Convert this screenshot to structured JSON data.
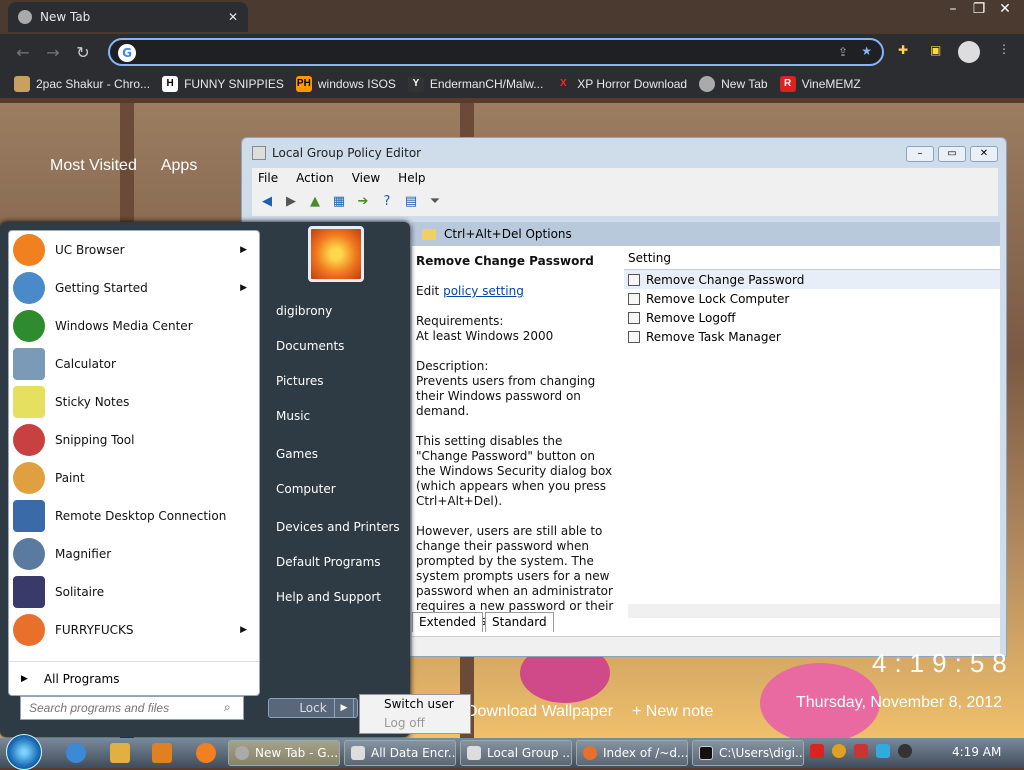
{
  "chrome": {
    "tab_title": "New Tab",
    "omnibox_value": "",
    "bookmarks": [
      {
        "label": "2pac Shakur - Chro...",
        "icon": "house-icon"
      },
      {
        "label": "FUNNY SNIPPIES",
        "icon": "h-letter-icon"
      },
      {
        "label": "windows ISOS",
        "icon": "ph-icon"
      },
      {
        "label": "EndermanCH/Malw...",
        "icon": "yp-icon"
      },
      {
        "label": "XP Horror Download",
        "icon": "x-icon"
      },
      {
        "label": "New Tab",
        "icon": "chrome-icon"
      },
      {
        "label": "VineMEMZ",
        "icon": "r-icon"
      }
    ],
    "ntp_most_visited": "Most Visited",
    "ntp_apps": "Apps"
  },
  "gpedit": {
    "title": "Local Group Policy Editor",
    "menu": [
      "File",
      "Action",
      "View",
      "Help"
    ],
    "header": "Ctrl+Alt+Del Options",
    "column_setting": "Setting",
    "desc_title": "Remove Change Password",
    "edit_prefix": "Edit",
    "edit_link": "policy setting",
    "requirements_label": "Requirements:",
    "requirements_value": "At least Windows 2000",
    "description_label": "Description:",
    "description_1": "Prevents users from changing their Windows password on demand.",
    "description_2": "This setting disables the \"Change Password\" button on the Windows Security dialog box (which appears when you press Ctrl+Alt+Del).",
    "description_3": "However, users are still able to change their password when prompted by the system. The system prompts users for a new password when an administrator requires a new password or their password is expiring.",
    "settings": [
      "Remove Change Password",
      "Remove Lock Computer",
      "Remove Logoff",
      "Remove Task Manager"
    ],
    "tabs": [
      "Extended",
      "Standard"
    ]
  },
  "startmenu": {
    "programs": [
      {
        "label": "UC Browser",
        "icon": "uc-browser-icon",
        "color": "#f08020",
        "submenu": true
      },
      {
        "label": "Getting Started",
        "icon": "getting-started-icon",
        "color": "#4a8ac8",
        "submenu": true
      },
      {
        "label": "Windows Media Center",
        "icon": "media-center-icon",
        "color": "#2e8b2e",
        "submenu": false
      },
      {
        "label": "Calculator",
        "icon": "calculator-icon",
        "color": "#7a9ab8",
        "submenu": false
      },
      {
        "label": "Sticky Notes",
        "icon": "sticky-notes-icon",
        "color": "#e6e060",
        "submenu": false
      },
      {
        "label": "Snipping Tool",
        "icon": "snipping-tool-icon",
        "color": "#c84040",
        "submenu": false
      },
      {
        "label": "Paint",
        "icon": "paint-icon",
        "color": "#e0a040",
        "submenu": false
      },
      {
        "label": "Remote Desktop Connection",
        "icon": "remote-desktop-icon",
        "color": "#3a6aa8",
        "submenu": false
      },
      {
        "label": "Magnifier",
        "icon": "magnifier-icon",
        "color": "#5a7aa0",
        "submenu": false
      },
      {
        "label": "Solitaire",
        "icon": "solitaire-icon",
        "color": "#3a3a6a",
        "submenu": false
      },
      {
        "label": "FURRYFUCKS",
        "icon": "firefox-icon",
        "color": "#e8702a",
        "submenu": true
      }
    ],
    "all_programs": "All Programs",
    "search_placeholder": "Search programs and files",
    "right_items": [
      "digibrony",
      "Documents",
      "Pictures",
      "Music",
      "Games",
      "Computer",
      "Devices and Printers",
      "Default Programs",
      "Help and Support"
    ],
    "lock_label": "Lock",
    "switch_user": "Switch user",
    "log_off": "Log off"
  },
  "desktop": {
    "download_wallpaper": "Download Wallpaper",
    "new_note": "+ New note",
    "big_time": "4:19:58",
    "date": "Thursday, November 8, 2012"
  },
  "taskbar": {
    "buttons": [
      "New Tab - G...",
      "All Data Encr...",
      "Local Group ...",
      "Index of /~d...",
      "C:\\Users\\digi..."
    ],
    "clock": "4:19 AM"
  }
}
